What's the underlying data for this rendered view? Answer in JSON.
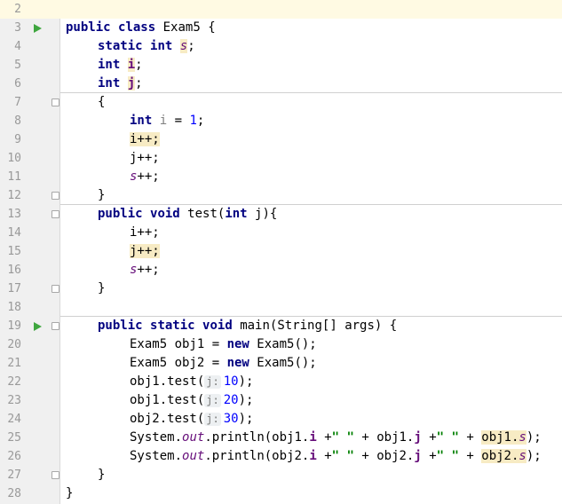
{
  "editor": {
    "line_numbers": [
      "2",
      "3",
      "4",
      "5",
      "6",
      "7",
      "8",
      "9",
      "10",
      "11",
      "12",
      "13",
      "14",
      "15",
      "16",
      "17",
      "18",
      "19",
      "20",
      "21",
      "22",
      "23",
      "24",
      "25",
      "26",
      "27",
      "28"
    ],
    "current_line": "2",
    "class_decl": {
      "kw_public": "public",
      "kw_class": "class",
      "name": "Exam5",
      "brace": " {"
    },
    "fields": {
      "s_static": "static",
      "s_int": "int",
      "s_name": "s",
      "semi": ";",
      "i_int": "int",
      "i_name": "i",
      "j_int": "int",
      "j_name": "j"
    },
    "init_block": {
      "open": "{",
      "local_int": "int",
      "local_i": "i",
      "assign": " = ",
      "one": "1",
      "i_inc": "i++;",
      "j_inc": "j++;",
      "s_name": "s",
      "inc": "++;",
      "close": "}"
    },
    "test_method": {
      "kw_public": "public",
      "kw_void": "void",
      "name": "test(",
      "param_int": "int",
      "param_rest": " j){",
      "i_inc": "i++;",
      "j_inc": "j++;",
      "s_name": "s",
      "inc": "++;",
      "close": "}"
    },
    "main_method": {
      "kw_public": "public",
      "kw_static": "static",
      "kw_void": "void",
      "signature": "main(String[] args) {",
      "obj1_decl": "Exam5 obj1 = ",
      "obj2_decl": "Exam5 obj2 = ",
      "kw_new": "new",
      "ctor": " Exam5();",
      "call1_prefix": "obj1.test(",
      "call2_prefix": "obj1.test(",
      "call3_prefix": "obj2.test(",
      "hint": "j:",
      "arg1": "10",
      "arg2": "20",
      "arg3": "30",
      "call_suffix": ");",
      "sys": "System.",
      "out": "out",
      "println": ".println(",
      "p1_obj": "obj1.",
      "p2_obj": "obj2.",
      "f_i": "i",
      "f_j": "j",
      "f_s": "s",
      "plus": " +",
      "space_str": "\" \"",
      "plus_space": "+ ",
      "end_paren": ");",
      "close": "}"
    },
    "class_close": "}"
  },
  "colors": {
    "keyword": "#000080",
    "static_field": "#660e7a",
    "number": "#0000ff",
    "string": "#008000",
    "usage_highlight": "#f7ebc4",
    "current_line": "#fffae3",
    "gutter": "#f0f0f0",
    "run_icon": "#3fa63f"
  }
}
